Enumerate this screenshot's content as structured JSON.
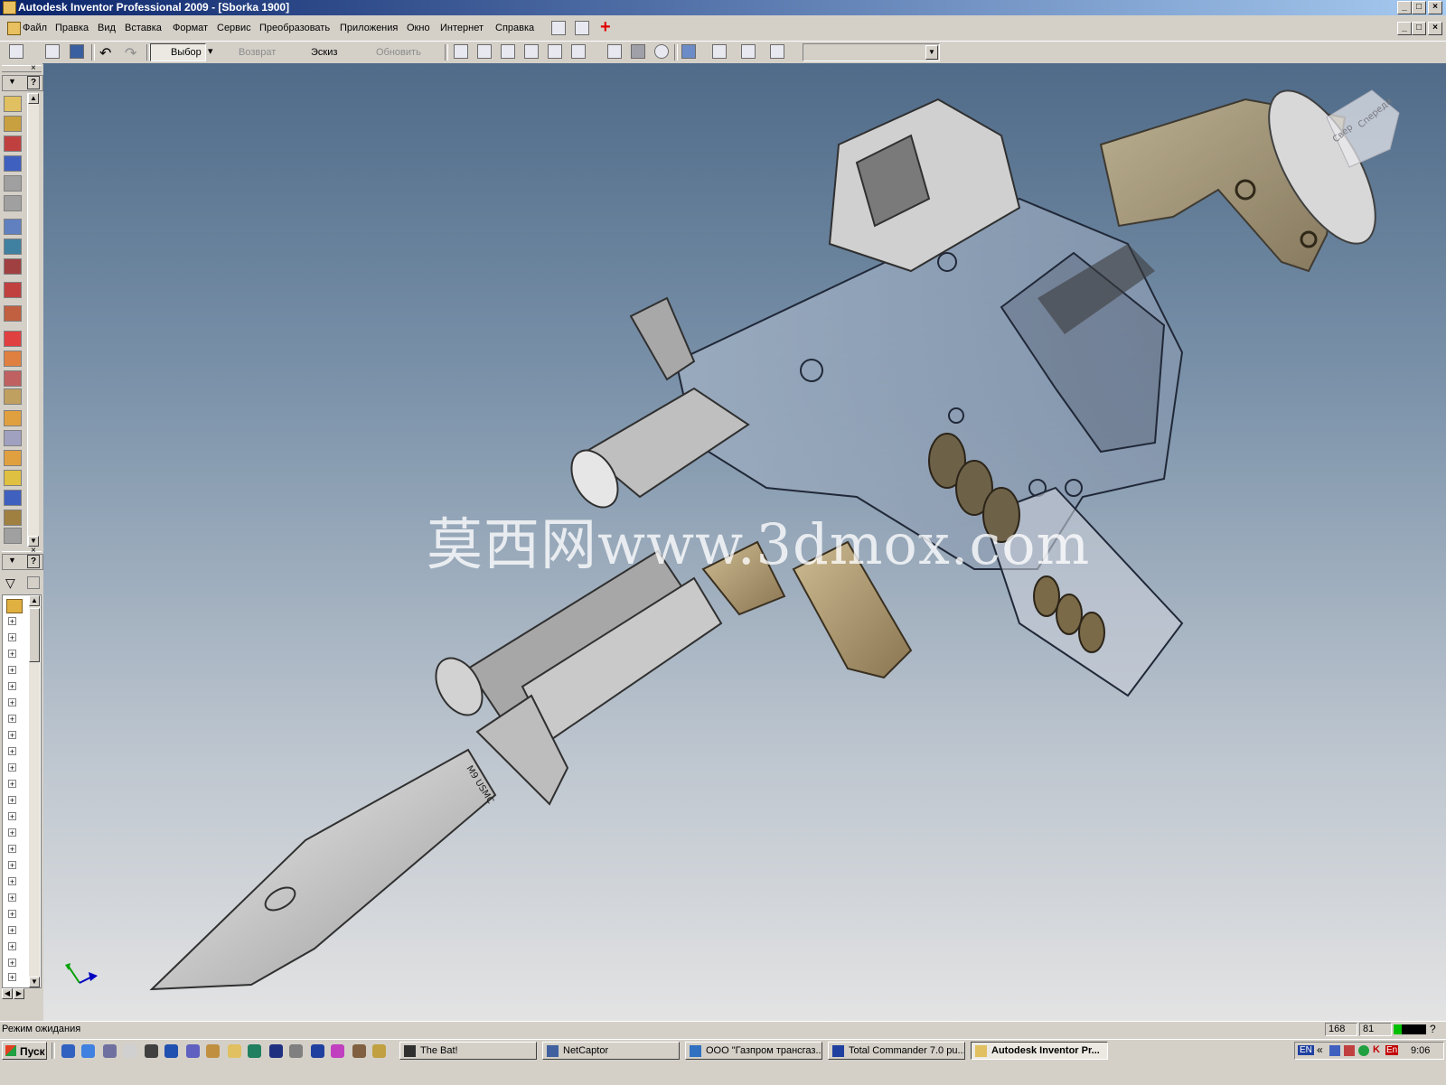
{
  "window": {
    "title": "Autodesk Inventor Professional 2009 - [Sborka 1900]"
  },
  "menu": [
    "Файл",
    "Правка",
    "Вид",
    "Вставка",
    "Формат",
    "Сервис",
    "Преобразовать",
    "Приложения",
    "Окно",
    "Интернет",
    "Справка"
  ],
  "toolbar": {
    "select_label": "Выбор",
    "return_label": "Возврат",
    "sketch_label": "Эскиз",
    "update_label": "Обновить"
  },
  "viewport": {
    "watermark": "莫西网www.3dmox.com",
    "viewcube_labels": [
      "Свер",
      "Спереди"
    ]
  },
  "model_engraving": "M9 USMC",
  "status": {
    "text": "Режим ожидания",
    "field1": "168",
    "field2": "81"
  },
  "taskbar": {
    "start_label": "Пуск",
    "tasks": [
      {
        "label": "The Bat!",
        "active": false
      },
      {
        "label": "NetCaptor",
        "active": false
      },
      {
        "label": "ООО \"Газпром трансгаз...",
        "active": false
      },
      {
        "label": "Total Commander 7.0 pu...",
        "active": false
      },
      {
        "label": "Autodesk Inventor Pr...",
        "active": true
      }
    ],
    "tray_lang": "EN",
    "tray_lang2": "En",
    "clock": "9:06"
  },
  "colors": {
    "title_start": "#0a246a",
    "title_end": "#a6caf0",
    "viewport_top": "#4f6b89",
    "viewport_bottom": "#e3e3e3",
    "chrome": "#d4d0c8"
  }
}
